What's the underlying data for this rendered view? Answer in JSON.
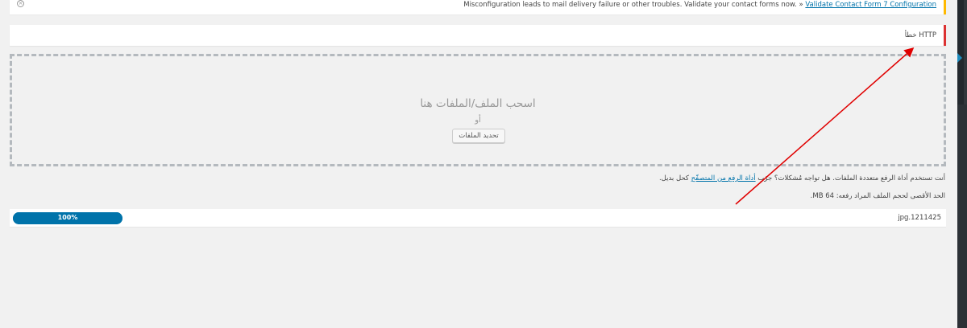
{
  "notice_top": {
    "text": "Misconfiguration leads to mail delivery failure or other troubles. Validate your contact forms now. »",
    "link_label": "Validate Contact Form 7 Configuration",
    "accent_color": "#ffb900"
  },
  "error_notice": {
    "text": "خطأ HTTP",
    "accent_color": "#dc3232"
  },
  "uploader": {
    "drop_title": "اسحب الملف/الملفات هنا",
    "or_text": "أو",
    "select_button": "تحديد الملفات"
  },
  "info": {
    "line1_before": "أنت تستخدم أداة الرفع متعددة الملفات. هل تواجه مُشكلات؟ جرّب",
    "line1_link": "أداة الرفع من المتصفّح",
    "line1_after": "كحل بديل.",
    "line2": "الحد الأقصى لحجم الملف المراد رفعه: 64 MB."
  },
  "upload_item": {
    "filename": "jpg.1211425",
    "progress_label": "100%",
    "progress_percent": 100,
    "progress_color": "#0073aa"
  },
  "annotation": {
    "arrow_color": "#e00000"
  }
}
